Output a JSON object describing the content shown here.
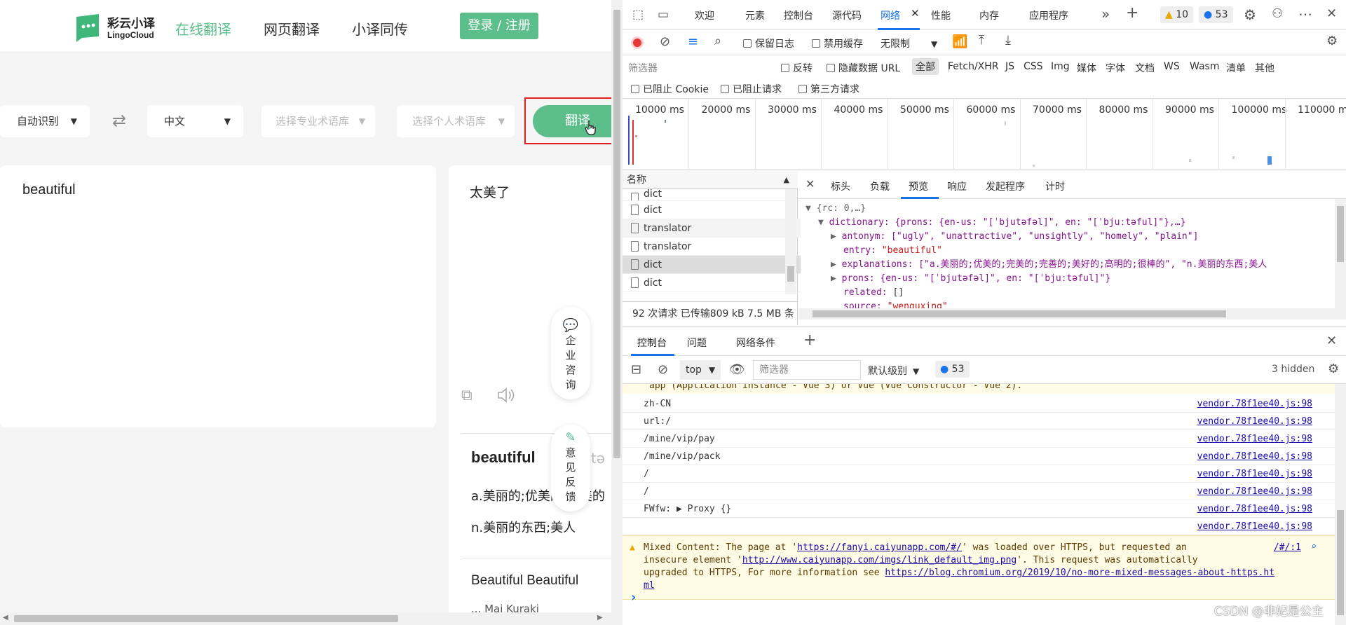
{
  "web": {
    "brand_cn": "彩云小译",
    "brand_en": "LingoCloud",
    "nav": [
      "在线翻译",
      "网页翻译",
      "小译同传"
    ],
    "login": "登录 / 注册",
    "source_lang": "自动识别",
    "target_lang": "中文",
    "domain_placeholder": "选择专业术语库",
    "personal_placeholder": "选择个人术语库",
    "translate_button": "翻译",
    "input_text": "beautiful",
    "output_text": "太美了",
    "float_consult": [
      "企",
      "业",
      "咨",
      "询"
    ],
    "float_feedback": [
      "意",
      "见",
      "反",
      "馈"
    ],
    "dict_word": "beautiful",
    "dict_pron": "[ˈbjuːtə",
    "dict_adj": "a.美丽的;优美的;完美的",
    "dict_noun": "n.美丽的东西;美人",
    "related_title": "Beautiful Beautiful",
    "related_sub": "... Mai Kuraki"
  },
  "devtools": {
    "tabs": [
      "欢迎",
      "元素",
      "控制台",
      "源代码",
      "网络",
      "性能",
      "内存",
      "应用程序"
    ],
    "active_tab": "网络",
    "warn_count": "10",
    "msg_count": "53",
    "network_toolbar": {
      "preserve_log": "保留日志",
      "disable_cache": "禁用缓存",
      "throttle": "无限制"
    },
    "filter": {
      "placeholder": "筛选器",
      "invert": "反转",
      "hide_data_urls": "隐藏数据 URL",
      "types": [
        "全部",
        "Fetch/XHR",
        "JS",
        "CSS",
        "Img",
        "媒体",
        "字体",
        "文档",
        "WS",
        "Wasm",
        "清单",
        "其他"
      ],
      "blocked_cookies": "已阻止 Cookie",
      "blocked_requests": "已阻止请求",
      "third_party": "第三方请求"
    },
    "timeline": [
      "10000 ms",
      "20000 ms",
      "30000 ms",
      "40000 ms",
      "50000 ms",
      "60000 ms",
      "70000 ms",
      "80000 ms",
      "90000 ms",
      "100000 ms",
      "110000 m"
    ],
    "request_list": {
      "header": "名称",
      "items": [
        "dict",
        "dict",
        "translator",
        "translator",
        "dict",
        "dict"
      ],
      "summary": "92 次请求  已传输809 kB  7.5 MB 条"
    },
    "detail_tabs": [
      "标头",
      "负载",
      "预览",
      "响应",
      "发起程序",
      "计时"
    ],
    "active_detail": "预览",
    "preview": {
      "root": "{rc: 0,…}",
      "dictionary_line": "dictionary: {prons: {en-us: \"[ˈbjutəfəl]\", en: \"[ˈbjuːtəful]\"},…}",
      "antonym": "antonym: [\"ugly\", \"unattractive\", \"unsightly\", \"homely\", \"plain\"]",
      "entry_key": "entry:",
      "entry_val": "\"beautiful\"",
      "explanations": "explanations: [\"a.美丽的;优美的;完美的;完善的;美好的;高明的;很棒的\", \"n.美丽的东西;美人",
      "prons": "prons: {en-us: \"[ˈbjutəfəl]\", en: \"[ˈbjuːtəful]\"}",
      "related_key": "related:",
      "related_val": "[]",
      "source_key": "source:",
      "source_val": "\"wenquxing\""
    },
    "drawer": {
      "tabs": [
        "控制台",
        "问题",
        "网络条件"
      ],
      "context": "top",
      "filter_placeholder": "筛选器",
      "level": "默认级别",
      "msg_count": "53",
      "hidden": "3 hidden"
    },
    "console": {
      "top_line": "app  (Application instance - Vue 3) or  Vue  (Vue Constructor - Vue 2).",
      "rows": [
        {
          "text": "zh-CN",
          "src": "vendor.78f1ee40.js:98"
        },
        {
          "text": "url:/",
          "src": "vendor.78f1ee40.js:98"
        },
        {
          "text": "/mine/vip/pay",
          "src": "vendor.78f1ee40.js:98"
        },
        {
          "text": "/mine/vip/pack",
          "src": "vendor.78f1ee40.js:98"
        },
        {
          "text": "/",
          "src": "vendor.78f1ee40.js:98"
        },
        {
          "text": "/",
          "src": "vendor.78f1ee40.js:98"
        },
        {
          "text": "FWfw:  ▶ Proxy {}",
          "src": "vendor.78f1ee40.js:98"
        },
        {
          "text": "",
          "src": "vendor.78f1ee40.js:98"
        }
      ],
      "warning_1": "Mixed Content: The page at '",
      "warning_url1": "https://fanyi.caiyunapp.com/#/",
      "warning_2": "' was loaded over HTTPS, but requested an",
      "warning_3": "insecure element '",
      "warning_url2": "http://www.caiyunapp.com/imgs/link_default_img.png",
      "warning_4": "'. This request was automatically",
      "warning_5": "upgraded to HTTPS, For more information see ",
      "warning_url3": "https://blog.chromium.org/2019/10/no-more-mixed-messages-about-https.ht",
      "warning_url3b": "ml",
      "warning_src": "/#/:1",
      "prompt": "›"
    },
    "watermark": "CSDN @非妃是公主"
  }
}
